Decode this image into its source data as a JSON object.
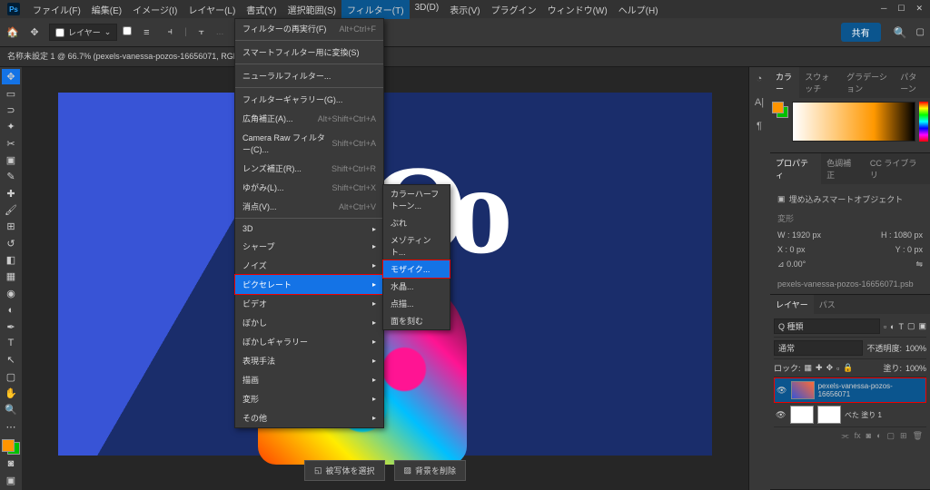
{
  "app_icon": "Ps",
  "menubar": [
    "ファイル(F)",
    "編集(E)",
    "イメージ(I)",
    "レイヤー(L)",
    "書式(Y)",
    "選択範囲(S)",
    "フィルター(T)",
    "3D(D)",
    "表示(V)",
    "プラグイン",
    "ウィンドウ(W)",
    "ヘルプ(H)"
  ],
  "menubar_active_index": 6,
  "optionbar": {
    "layer_label": "レイヤー",
    "share": "共有"
  },
  "doc_tab": "名称未設定 1 @ 66.7% (pexels-vanessa-pozos-16656071, RGB/8) *",
  "filter_menu": {
    "items": [
      {
        "t": "row",
        "label": "フィルターの再実行(F)",
        "shortcut": "Alt+Ctrl+F"
      },
      {
        "t": "sep"
      },
      {
        "t": "row",
        "label": "スマートフィルター用に変換(S)"
      },
      {
        "t": "sep"
      },
      {
        "t": "row",
        "label": "ニューラルフィルター..."
      },
      {
        "t": "sep"
      },
      {
        "t": "row",
        "label": "フィルターギャラリー(G)..."
      },
      {
        "t": "row",
        "label": "広角補正(A)...",
        "shortcut": "Alt+Shift+Ctrl+A"
      },
      {
        "t": "row",
        "label": "Camera Raw フィルター(C)...",
        "shortcut": "Shift+Ctrl+A"
      },
      {
        "t": "row",
        "label": "レンズ補正(R)...",
        "shortcut": "Shift+Ctrl+R"
      },
      {
        "t": "row",
        "label": "ゆがみ(L)...",
        "shortcut": "Shift+Ctrl+X"
      },
      {
        "t": "row",
        "label": "消点(V)...",
        "shortcut": "Alt+Ctrl+V"
      },
      {
        "t": "sep"
      },
      {
        "t": "sub",
        "label": "3D"
      },
      {
        "t": "sub",
        "label": "シャープ"
      },
      {
        "t": "sub",
        "label": "ノイズ"
      },
      {
        "t": "sub",
        "label": "ピクセレート",
        "hl": true
      },
      {
        "t": "sub",
        "label": "ビデオ"
      },
      {
        "t": "sub",
        "label": "ぼかし"
      },
      {
        "t": "sub",
        "label": "ぼかしギャラリー"
      },
      {
        "t": "sub",
        "label": "表現手法"
      },
      {
        "t": "sub",
        "label": "描画"
      },
      {
        "t": "sub",
        "label": "変形"
      },
      {
        "t": "sub",
        "label": "その他"
      }
    ]
  },
  "pixelate_submenu": [
    "カラーハーフトーン...",
    "ぶれ",
    "メゾティント...",
    "モザイク...",
    "水晶...",
    "点描...",
    "面を刻む"
  ],
  "pixelate_hl_index": 3,
  "bottom_actions": {
    "select_subject": "被写体を選択",
    "remove_bg": "背景を削除"
  },
  "panels": {
    "color": {
      "tabs": [
        "カラー",
        "スウォッチ",
        "グラデーション",
        "パターン"
      ]
    },
    "properties": {
      "tabs": [
        "プロパティ",
        "色調補正",
        "CC ライブラリ"
      ],
      "header": "埋め込みスマートオブジェクト",
      "section": "変形",
      "w_label": "W :",
      "w_val": "1920 px",
      "h_label": "H :",
      "h_val": "1080 px",
      "x_label": "X :",
      "x_val": "0 px",
      "y_label": "Y :",
      "y_val": "0 px",
      "angle_label": "⊿",
      "angle_val": "0.00°",
      "filename": "pexels-vanessa-pozos-16656071.psb"
    },
    "layers": {
      "tabs": [
        "レイヤー",
        "パス"
      ],
      "kind": "Q 種類",
      "blend": "通常",
      "opacity_label": "不透明度:",
      "opacity": "100%",
      "lock_label": "ロック:",
      "fill_label": "塗り:",
      "fill": "100%",
      "rows": [
        {
          "name": "pexels-vanessa-pozos-16656071",
          "selected": true,
          "thumb": "img"
        },
        {
          "name": "べた 塗り 1",
          "selected": false,
          "thumb": "white"
        }
      ]
    }
  },
  "graffiti_text": "ɔOo"
}
